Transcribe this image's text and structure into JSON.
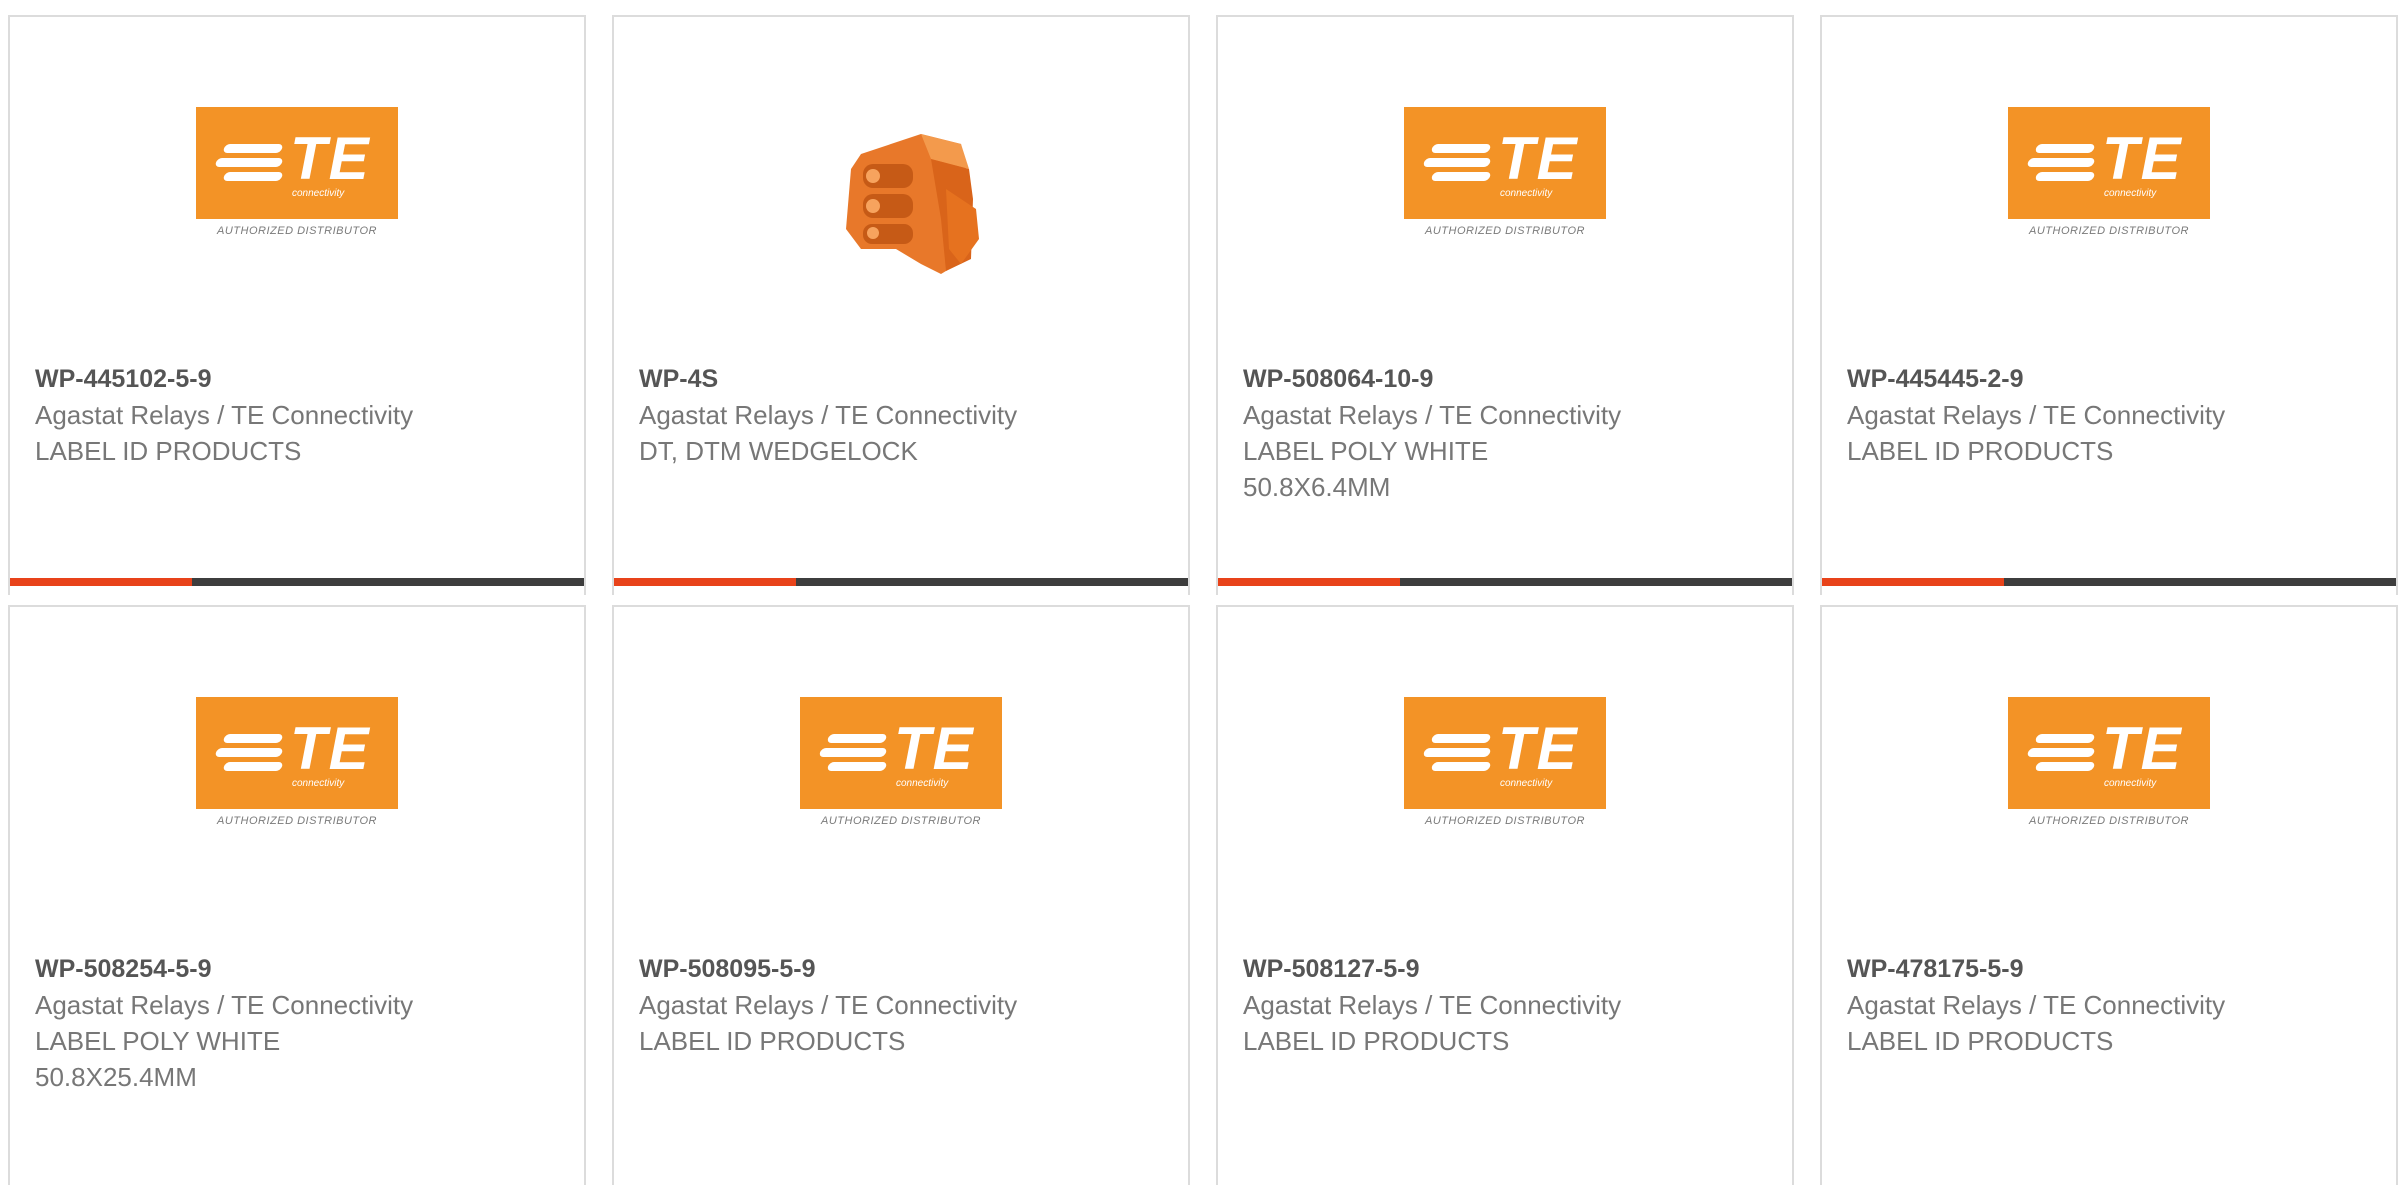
{
  "logo": {
    "brand": "TE",
    "sub": "connectivity",
    "tagline": "AUTHORIZED DISTRIBUTOR",
    "brand_color": "#f39326"
  },
  "accent_colors": {
    "accent": "#e8431a",
    "bar": "#3d3d3d"
  },
  "products": [
    {
      "part_number": "WP-445102-5-9",
      "manufacturer": "Agastat Relays / TE Connectivity",
      "description_lines": [
        "LABEL ID PRODUCTS"
      ],
      "image": "te-logo"
    },
    {
      "part_number": "WP-4S",
      "manufacturer": "Agastat Relays / TE Connectivity",
      "description_lines": [
        "DT, DTM WEDGELOCK"
      ],
      "image": "wedgelock-photo"
    },
    {
      "part_number": "WP-508064-10-9",
      "manufacturer": "Agastat Relays / TE Connectivity",
      "description_lines": [
        "LABEL POLY WHITE",
        "50.8X6.4MM"
      ],
      "image": "te-logo"
    },
    {
      "part_number": "WP-445445-2-9",
      "manufacturer": "Agastat Relays / TE Connectivity",
      "description_lines": [
        "LABEL ID PRODUCTS"
      ],
      "image": "te-logo"
    },
    {
      "part_number": "WP-508254-5-9",
      "manufacturer": "Agastat Relays / TE Connectivity",
      "description_lines": [
        "LABEL POLY WHITE",
        "50.8X25.4MM"
      ],
      "image": "te-logo"
    },
    {
      "part_number": "WP-508095-5-9",
      "manufacturer": "Agastat Relays / TE Connectivity",
      "description_lines": [
        "LABEL ID PRODUCTS"
      ],
      "image": "te-logo"
    },
    {
      "part_number": "WP-508127-5-9",
      "manufacturer": "Agastat Relays / TE Connectivity",
      "description_lines": [
        "LABEL ID PRODUCTS"
      ],
      "image": "te-logo"
    },
    {
      "part_number": "WP-478175-5-9",
      "manufacturer": "Agastat Relays / TE Connectivity",
      "description_lines": [
        "LABEL ID PRODUCTS"
      ],
      "image": "te-logo"
    }
  ]
}
